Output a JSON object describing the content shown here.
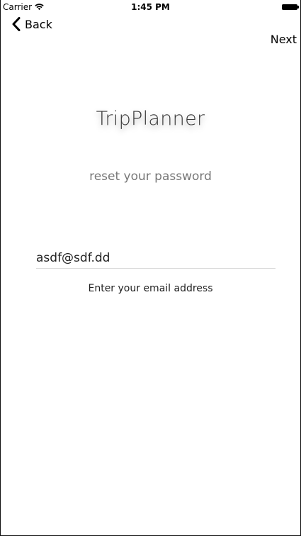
{
  "status_bar": {
    "carrier": "Carrier",
    "time": "1:45 PM"
  },
  "nav": {
    "back_label": "Back",
    "next_label": "Next"
  },
  "content": {
    "app_title": "TripPlanner",
    "subtitle": "reset your password",
    "email_value": "asdf@sdf.dd",
    "helper_text": "Enter your email address"
  }
}
